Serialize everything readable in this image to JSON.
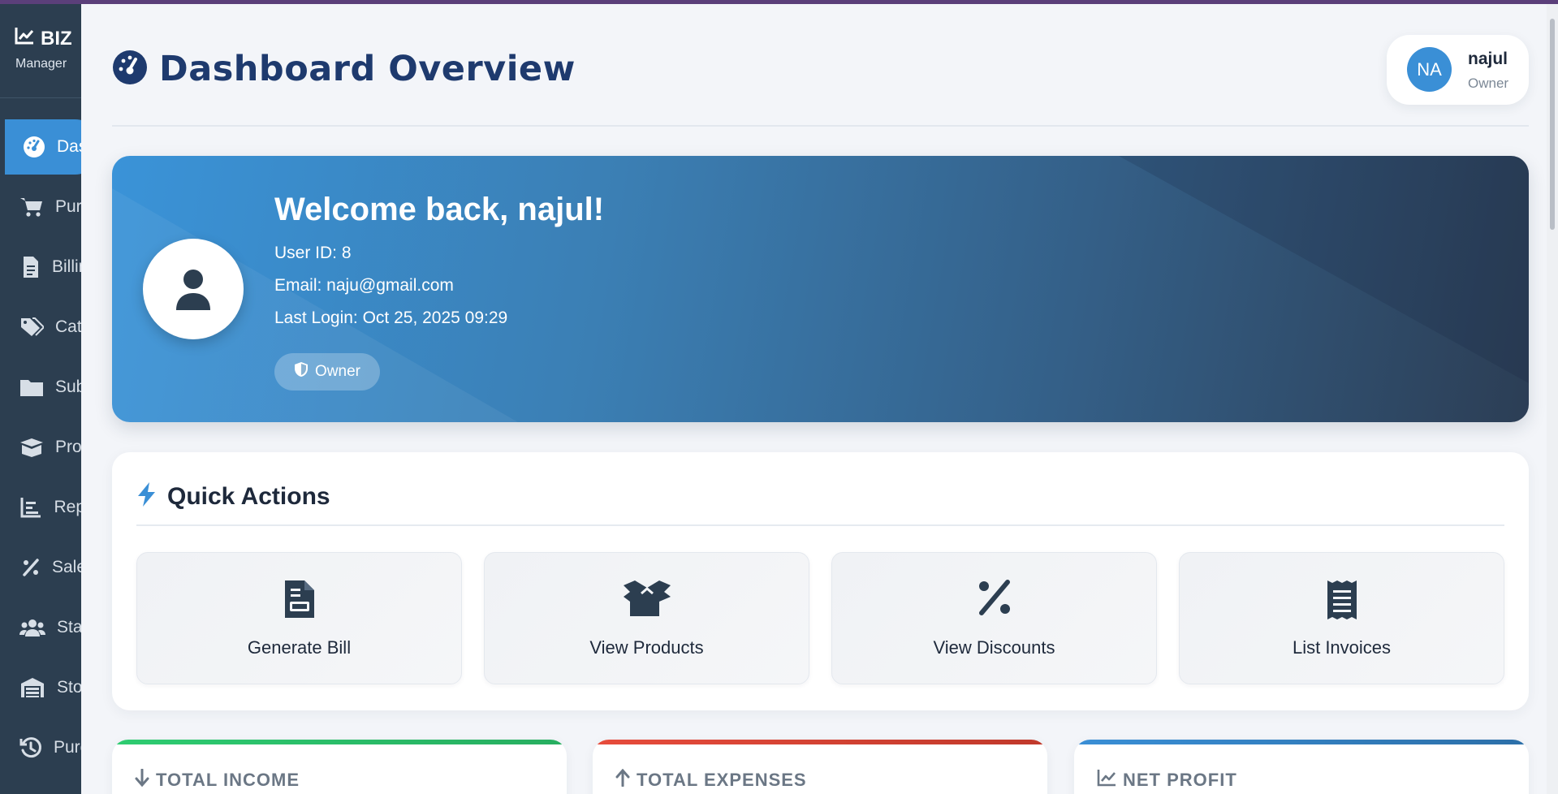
{
  "sidebar": {
    "brand_name": "BIZ",
    "brand_subtitle": "Manager",
    "items": [
      {
        "label": "Dashboard",
        "icon": "gauge-icon",
        "active": true
      },
      {
        "label": "Purchases",
        "icon": "cart-icon"
      },
      {
        "label": "Billing",
        "icon": "invoice-icon"
      },
      {
        "label": "Categories",
        "icon": "tags-icon"
      },
      {
        "label": "Subcategories",
        "icon": "folder-icon"
      },
      {
        "label": "Products",
        "icon": "box-icon"
      },
      {
        "label": "Reports",
        "icon": "chart-icon"
      },
      {
        "label": "Sales",
        "icon": "percent-icon"
      },
      {
        "label": "Staff",
        "icon": "users-icon"
      },
      {
        "label": "Stock",
        "icon": "warehouse-icon"
      },
      {
        "label": "Purchase History",
        "icon": "history-icon"
      }
    ]
  },
  "header": {
    "title": "Dashboard Overview"
  },
  "user": {
    "initials": "NA",
    "name": "najul",
    "role": "Owner"
  },
  "welcome": {
    "heading": "Welcome back, najul!",
    "user_id": "User ID: 8",
    "email": "Email: naju@gmail.com",
    "last_login": "Last Login: Oct 25, 2025 09:29",
    "role_badge": "Owner"
  },
  "quick_actions": {
    "title": "Quick Actions",
    "items": [
      {
        "label": "Generate Bill",
        "icon": "bill-icon"
      },
      {
        "label": "View Products",
        "icon": "box-open-icon"
      },
      {
        "label": "View Discounts",
        "icon": "percent-icon"
      },
      {
        "label": "List Invoices",
        "icon": "receipt-icon"
      }
    ]
  },
  "stats": [
    {
      "label": "TOTAL INCOME",
      "icon": "arrow-down-icon",
      "color": "#27ae60"
    },
    {
      "label": "TOTAL EXPENSES",
      "icon": "arrow-up-icon",
      "color": "#c0392b"
    },
    {
      "label": "NET PROFIT",
      "icon": "line-chart-icon",
      "color": "#2c7cc0"
    }
  ],
  "colors": {
    "sidebar_bg": "#2c3e50",
    "accent": "#3a8fd6",
    "title": "#1e3a6e"
  }
}
